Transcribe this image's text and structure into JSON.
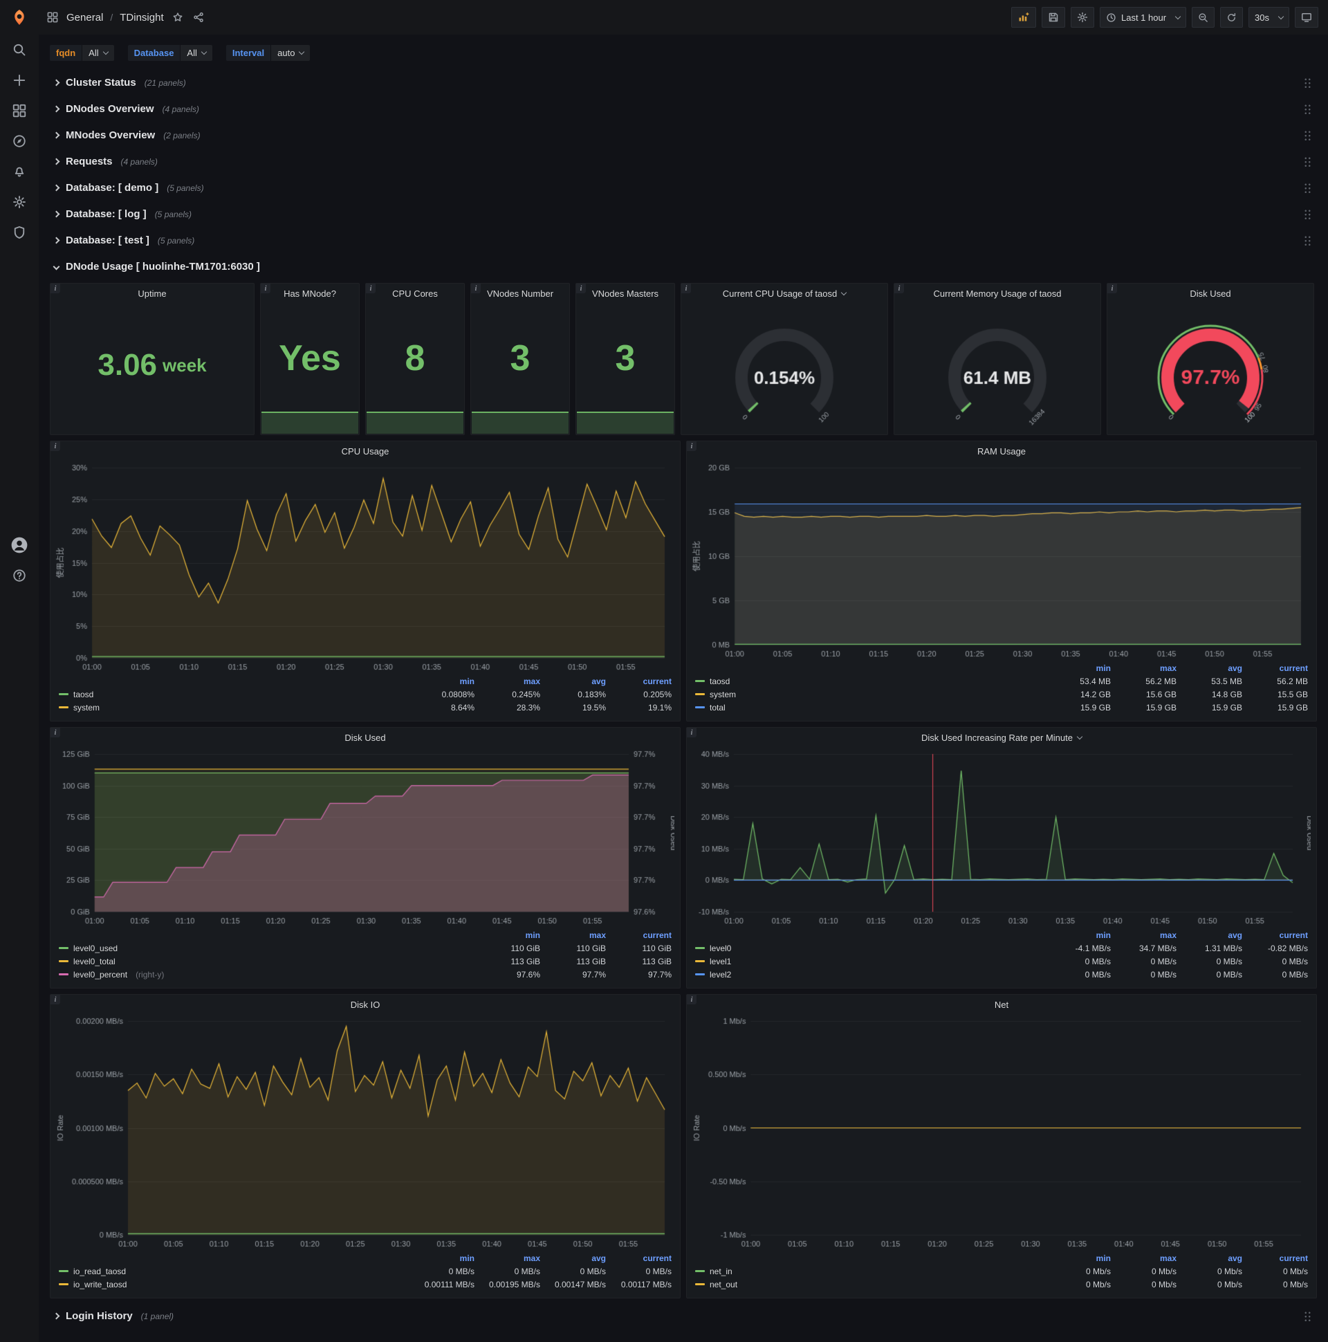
{
  "icons": {
    "panel_info": "i",
    "help_glyph": "?"
  },
  "navbar": {
    "breadcrumb": {
      "folder": "General",
      "sep": "/",
      "dashboard": "TDinsight"
    },
    "time_picker": "Last 1 hour",
    "refresh": "30s"
  },
  "filters": [
    {
      "label": "fqdn",
      "value": "All",
      "label_color": "#e58c27"
    },
    {
      "label": "Database",
      "value": "All",
      "label_color": "#5794F2"
    },
    {
      "label": "Interval",
      "value": "auto",
      "label_color": "#5794F2"
    }
  ],
  "collapsed_rows": [
    {
      "title": "Cluster Status",
      "count": "(21 panels)"
    },
    {
      "title": "DNodes Overview",
      "count": "(4 panels)"
    },
    {
      "title": "MNodes Overview",
      "count": "(2 panels)"
    },
    {
      "title": "Requests",
      "count": "(4 panels)"
    },
    {
      "title": "Database: [ demo ]",
      "count": "(5 panels)"
    },
    {
      "title": "Database: [ log ]",
      "count": "(5 panels)"
    },
    {
      "title": "Database: [ test ]",
      "count": "(5 panels)"
    }
  ],
  "expanded_row": {
    "title": "DNode Usage [ huolinhe-TM1701:6030 ]"
  },
  "bottom_row": {
    "title": "Login History",
    "count": "(1 panel)"
  },
  "stat_panels": [
    {
      "title": "Uptime",
      "value": "3.06",
      "suffix": "week",
      "sparkline": false
    },
    {
      "title": "Has MNode?",
      "value": "Yes",
      "sparkline": true
    },
    {
      "title": "CPU Cores",
      "value": "8",
      "sparkline": true
    },
    {
      "title": "VNodes Number",
      "value": "3",
      "sparkline": true
    },
    {
      "title": "VNodes Masters",
      "value": "3",
      "sparkline": true
    }
  ],
  "gauge_panels": [
    {
      "title": "Current CPU Usage of taosd",
      "caret": true,
      "value": "0.154%",
      "frac": 0.00154,
      "min_label": "0",
      "max_label": "100",
      "value_color": "#e6e7e8",
      "arc_color": "#73BF69",
      "big": false
    },
    {
      "title": "Current Memory Usage of taosd",
      "caret": false,
      "value": "61.4 MB",
      "frac": 0.00375,
      "min_label": "0",
      "max_label": "16384",
      "value_color": "#e6e7e8",
      "arc_color": "#73BF69",
      "big": false
    },
    {
      "title": "Disk Used",
      "caret": false,
      "value": "97.7%",
      "frac": 0.977,
      "min_label": "0",
      "max_label": "100",
      "value_color": "#F2495C",
      "arc_color": "#F2495C",
      "big": true,
      "thresholds": [
        {
          "frac": 0.75,
          "label": "75"
        },
        {
          "frac": 0.8,
          "label": "80"
        },
        {
          "frac": 0.95,
          "label": "95"
        },
        {
          "frac": 1.0,
          "label": "100"
        }
      ],
      "ring": [
        {
          "to": 0.75,
          "color": "#73BF69"
        },
        {
          "to": 0.8,
          "color": "#FF9830"
        },
        {
          "to": 1.0,
          "color": "#F2495C"
        }
      ]
    }
  ],
  "charts": {
    "cpu_usage": {
      "title": "CPU Usage",
      "type": "line",
      "ylabel": "使用占比",
      "ymin": 0,
      "ymax": 30,
      "yticks": [
        [
          0,
          "0%"
        ],
        [
          5,
          "5%"
        ],
        [
          10,
          "10%"
        ],
        [
          15,
          "15%"
        ],
        [
          20,
          "20%"
        ],
        [
          25,
          "25%"
        ],
        [
          30,
          "30%"
        ]
      ],
      "xticks": [
        "01:00",
        "01:05",
        "01:10",
        "01:15",
        "01:20",
        "01:25",
        "01:30",
        "01:35",
        "01:40",
        "01:45",
        "01:50",
        "01:55"
      ],
      "series": [
        {
          "name": "system",
          "color": "#EAB839",
          "fill": 0.12,
          "values": [
            21.9,
            19.2,
            17.4,
            21.2,
            22.4,
            18.9,
            16.2,
            20.8,
            19.4,
            17.8,
            13.1,
            9.6,
            11.8,
            8.64,
            12.4,
            17.2,
            24.8,
            20.3,
            16.9,
            22.6,
            25.9,
            18.4,
            21.7,
            24.2,
            19.8,
            22.9,
            17.3,
            20.6,
            24.9,
            21.2,
            28.3,
            21.4,
            19.2,
            25.6,
            20.1,
            27.2,
            22.8,
            18.3,
            21.9,
            24.6,
            17.6,
            20.9,
            23.4,
            26.1,
            19.5,
            17.1,
            22.4,
            26.8,
            18.7,
            15.9,
            21.6,
            27.4,
            23.9,
            20.2,
            26.3,
            22.1,
            27.8,
            24.3,
            21.7,
            19.1
          ]
        },
        {
          "name": "taosd",
          "color": "#73BF69",
          "fill": 0.15,
          "values": 0.2,
          "n": 60
        }
      ],
      "legend": {
        "cols": [
          "min",
          "max",
          "avg",
          "current"
        ],
        "rows": [
          {
            "name": "taosd",
            "color": "#73BF69",
            "vals": [
              "0.0808%",
              "0.245%",
              "0.183%",
              "0.205%"
            ]
          },
          {
            "name": "system",
            "color": "#EAB839",
            "vals": [
              "8.64%",
              "28.3%",
              "19.5%",
              "19.1%"
            ]
          }
        ]
      }
    },
    "ram_usage": {
      "title": "RAM Usage",
      "type": "line",
      "ylabel": "使用占比",
      "ymin": 0,
      "ymax": 20,
      "yticks": [
        [
          0,
          "0 MB"
        ],
        [
          5,
          "5 GB"
        ],
        [
          10,
          "10 GB"
        ],
        [
          15,
          "15 GB"
        ],
        [
          20,
          "20 GB"
        ]
      ],
      "xticks": [
        "01:00",
        "01:05",
        "01:10",
        "01:15",
        "01:20",
        "01:25",
        "01:30",
        "01:35",
        "01:40",
        "01:45",
        "01:50",
        "01:55"
      ],
      "series": [
        {
          "name": "system",
          "color": "#EAB839",
          "fill": 0.12,
          "values": [
            14.9,
            14.5,
            14.4,
            14.5,
            14.4,
            14.5,
            14.4,
            14.4,
            14.5,
            14.4,
            14.5,
            14.5,
            14.4,
            14.5,
            14.5,
            14.4,
            14.5,
            14.5,
            14.5,
            14.5,
            14.6,
            14.5,
            14.5,
            14.6,
            14.5,
            14.6,
            14.6,
            14.5,
            14.6,
            14.6,
            14.7,
            14.8,
            14.8,
            14.9,
            14.9,
            14.8,
            14.9,
            14.9,
            15.0,
            14.9,
            15.0,
            15.0,
            15.1,
            15.0,
            15.1,
            15.1,
            15.0,
            15.1,
            15.1,
            15.2,
            15.1,
            15.2,
            15.2,
            15.1,
            15.2,
            15.2,
            15.3,
            15.3,
            15.4,
            15.5
          ]
        },
        {
          "name": "total",
          "color": "#5794F2",
          "fill": 0.1,
          "values": 15.9,
          "n": 60
        },
        {
          "name": "taosd",
          "color": "#73BF69",
          "fill": 0.2,
          "values": 0.054,
          "n": 60
        }
      ],
      "legend": {
        "cols": [
          "min",
          "max",
          "avg",
          "current"
        ],
        "rows": [
          {
            "name": "taosd",
            "color": "#73BF69",
            "vals": [
              "53.4 MB",
              "56.2 MB",
              "53.5 MB",
              "56.2 MB"
            ]
          },
          {
            "name": "system",
            "color": "#EAB839",
            "vals": [
              "14.2 GB",
              "15.6 GB",
              "14.8 GB",
              "15.5 GB"
            ]
          },
          {
            "name": "total",
            "color": "#5794F2",
            "vals": [
              "15.9 GB",
              "15.9 GB",
              "15.9 GB",
              "15.9 GB"
            ]
          }
        ]
      }
    },
    "disk_used": {
      "title": "Disk Used",
      "type": "line",
      "ymin": 0,
      "ymax": 125,
      "yticks": [
        [
          0,
          "0 GiB"
        ],
        [
          25,
          "25 GiB"
        ],
        [
          50,
          "50 GiB"
        ],
        [
          75,
          "75 GiB"
        ],
        [
          100,
          "100 GiB"
        ],
        [
          125,
          "125 GiB"
        ]
      ],
      "xticks": [
        "01:00",
        "01:05",
        "01:10",
        "01:15",
        "01:20",
        "01:25",
        "01:30",
        "01:35",
        "01:40",
        "01:45",
        "01:50",
        "01:55"
      ],
      "axis2": {
        "min": 97.575,
        "max": 97.725,
        "label": "Disk Used",
        "ticks": [
          "97.6%",
          "97.7%",
          "97.7%",
          "97.7%",
          "97.7%",
          "97.7%"
        ]
      },
      "series": [
        {
          "name": "level0_used",
          "color": "#73BF69",
          "fill": 0.18,
          "values": 110,
          "n": 60
        },
        {
          "name": "level0_total",
          "color": "#EAB839",
          "fill": 0.06,
          "values": 113,
          "n": 60
        },
        {
          "name": "level0_percent",
          "color": "#D66BB0",
          "fill": 0.28,
          "yaxis": 2,
          "values": [
            97.589,
            97.589,
            97.603,
            97.603,
            97.603,
            97.603,
            97.603,
            97.603,
            97.603,
            97.617,
            97.617,
            97.617,
            97.617,
            97.632,
            97.632,
            97.632,
            97.648,
            97.648,
            97.648,
            97.648,
            97.648,
            97.663,
            97.663,
            97.663,
            97.663,
            97.663,
            97.678,
            97.678,
            97.678,
            97.678,
            97.678,
            97.685,
            97.685,
            97.685,
            97.685,
            97.695,
            97.695,
            97.695,
            97.695,
            97.695,
            97.695,
            97.695,
            97.695,
            97.695,
            97.695,
            97.7,
            97.7,
            97.7,
            97.7,
            97.7,
            97.7,
            97.7,
            97.7,
            97.7,
            97.7,
            97.705,
            97.705,
            97.705,
            97.705,
            97.705
          ]
        }
      ],
      "legend": {
        "cols": [
          "min",
          "max",
          "current"
        ],
        "rows": [
          {
            "name": "level0_used",
            "color": "#73BF69",
            "vals": [
              "110 GiB",
              "110 GiB",
              "110 GiB"
            ]
          },
          {
            "name": "level0_total",
            "color": "#EAB839",
            "vals": [
              "113 GiB",
              "113 GiB",
              "113 GiB"
            ]
          },
          {
            "name": "level0_percent",
            "color": "#D66BB0",
            "suffix": "(right-y)",
            "vals": [
              "97.6%",
              "97.7%",
              "97.7%"
            ]
          }
        ]
      }
    },
    "disk_rate": {
      "title": "Disk Used Increasing Rate per Minute",
      "caret": true,
      "type": "line",
      "ymin": -10,
      "ymax": 40,
      "yticks": [
        [
          -10,
          "-10 MB/s"
        ],
        [
          0,
          "0 MB/s"
        ],
        [
          10,
          "10 MB/s"
        ],
        [
          20,
          "20 MB/s"
        ],
        [
          30,
          "30 MB/s"
        ],
        [
          40,
          "40 MB/s"
        ]
      ],
      "xticks": [
        "01:00",
        "01:05",
        "01:10",
        "01:15",
        "01:20",
        "01:25",
        "01:30",
        "01:35",
        "01:40",
        "01:45",
        "01:50",
        "01:55"
      ],
      "axis2": {
        "label": "Disk Used"
      },
      "vline": {
        "at": 21,
        "color": "#F2495C"
      },
      "series": [
        {
          "name": "level0",
          "color": "#73BF69",
          "fill": 0.12,
          "values": [
            0.3,
            0.2,
            18,
            0.4,
            -1.2,
            0.3,
            0.2,
            4,
            0.3,
            11.5,
            0.2,
            0.3,
            -0.6,
            0.2,
            0.4,
            20.5,
            -4.1,
            0.3,
            11,
            0.2,
            0.4,
            0.2,
            0.3,
            0.2,
            34.7,
            0.3,
            0.2,
            0.4,
            0.3,
            0.2,
            0.3,
            0.4,
            0.2,
            0.3,
            20,
            0.2,
            0.4,
            0.3,
            0.2,
            0.3,
            0.2,
            0.4,
            0.3,
            0.2,
            0.3,
            0.4,
            0.2,
            0.3,
            0.2,
            0.4,
            0.3,
            0.2,
            0.4,
            0.3,
            0.2,
            0.3,
            0.2,
            8.5,
            1.5,
            -0.82
          ]
        },
        {
          "name": "level1",
          "color": "#EAB839",
          "fill": 0,
          "values": 0,
          "n": 60
        },
        {
          "name": "level2",
          "color": "#5794F2",
          "fill": 0,
          "values": 0,
          "n": 60
        }
      ],
      "legend": {
        "cols": [
          "min",
          "max",
          "avg",
          "current"
        ],
        "rows": [
          {
            "name": "level0",
            "color": "#73BF69",
            "vals": [
              "-4.1 MB/s",
              "34.7 MB/s",
              "1.31 MB/s",
              "-0.82 MB/s"
            ]
          },
          {
            "name": "level1",
            "color": "#EAB839",
            "vals": [
              "0 MB/s",
              "0 MB/s",
              "0 MB/s",
              "0 MB/s"
            ]
          },
          {
            "name": "level2",
            "color": "#5794F2",
            "vals": [
              "0 MB/s",
              "0 MB/s",
              "0 MB/s",
              "0 MB/s"
            ]
          }
        ]
      }
    },
    "disk_io": {
      "title": "Disk IO",
      "type": "line",
      "ylabel": "IO Rate",
      "ymin": 0,
      "ymax": 0.002,
      "yticks": [
        [
          0,
          "0 MB/s"
        ],
        [
          0.0005,
          "0.000500 MB/s"
        ],
        [
          0.001,
          "0.00100 MB/s"
        ],
        [
          0.0015,
          "0.00150 MB/s"
        ],
        [
          0.002,
          "0.00200 MB/s"
        ]
      ],
      "xticks": [
        "01:00",
        "01:05",
        "01:10",
        "01:15",
        "01:20",
        "01:25",
        "01:30",
        "01:35",
        "01:40",
        "01:45",
        "01:50",
        "01:55"
      ],
      "series": [
        {
          "name": "io_write_taosd",
          "color": "#EAB839",
          "fill": 0.12,
          "values": [
            0.00135,
            0.00142,
            0.00128,
            0.00151,
            0.00139,
            0.00146,
            0.00132,
            0.00155,
            0.00141,
            0.00137,
            0.0016,
            0.00129,
            0.00148,
            0.00136,
            0.00152,
            0.00121,
            0.00158,
            0.00143,
            0.00131,
            0.00165,
            0.00138,
            0.00147,
            0.00126,
            0.00172,
            0.00195,
            0.00134,
            0.00149,
            0.0014,
            0.00162,
            0.00128,
            0.00154,
            0.00137,
            0.00168,
            0.00111,
            0.00145,
            0.00158,
            0.00126,
            0.00171,
            0.00139,
            0.00151,
            0.00133,
            0.00164,
            0.00142,
            0.00129,
            0.00157,
            0.00148,
            0.0019,
            0.00135,
            0.00127,
            0.00153,
            0.00144,
            0.00161,
            0.0013,
            0.00149,
            0.00138,
            0.00156,
            0.00125,
            0.00147,
            0.00132,
            0.00117
          ]
        },
        {
          "name": "io_read_taosd",
          "color": "#73BF69",
          "fill": 0.2,
          "values": 1e-05,
          "n": 60
        }
      ],
      "legend": {
        "cols": [
          "min",
          "max",
          "avg",
          "current"
        ],
        "rows": [
          {
            "name": "io_read_taosd",
            "color": "#73BF69",
            "vals": [
              "0 MB/s",
              "0 MB/s",
              "0 MB/s",
              "0 MB/s"
            ]
          },
          {
            "name": "io_write_taosd",
            "color": "#EAB839",
            "vals": [
              "0.00111 MB/s",
              "0.00195 MB/s",
              "0.00147 MB/s",
              "0.00117 MB/s"
            ]
          }
        ]
      }
    },
    "net": {
      "title": "Net",
      "type": "line",
      "ylabel": "IO Rate",
      "ymin": -1,
      "ymax": 1,
      "yticks": [
        [
          -1,
          "-1 Mb/s"
        ],
        [
          -0.5,
          "-0.50 Mb/s"
        ],
        [
          0,
          "0 Mb/s"
        ],
        [
          0.5,
          "0.500 Mb/s"
        ],
        [
          1,
          "1 Mb/s"
        ]
      ],
      "xticks": [
        "01:00",
        "01:05",
        "01:10",
        "01:15",
        "01:20",
        "01:25",
        "01:30",
        "01:35",
        "01:40",
        "01:45",
        "01:50",
        "01:55"
      ],
      "series": [
        {
          "name": "net_in",
          "color": "#73BF69",
          "fill": 0,
          "values": 0,
          "n": 60
        },
        {
          "name": "net_out",
          "color": "#EAB839",
          "fill": 0,
          "values": 0,
          "n": 60
        }
      ],
      "legend": {
        "cols": [
          "min",
          "max",
          "avg",
          "current"
        ],
        "rows": [
          {
            "name": "net_in",
            "color": "#73BF69",
            "vals": [
              "0 Mb/s",
              "0 Mb/s",
              "0 Mb/s",
              "0 Mb/s"
            ]
          },
          {
            "name": "net_out",
            "color": "#EAB839",
            "vals": [
              "0 Mb/s",
              "0 Mb/s",
              "0 Mb/s",
              "0 Mb/s"
            ]
          }
        ]
      }
    }
  }
}
